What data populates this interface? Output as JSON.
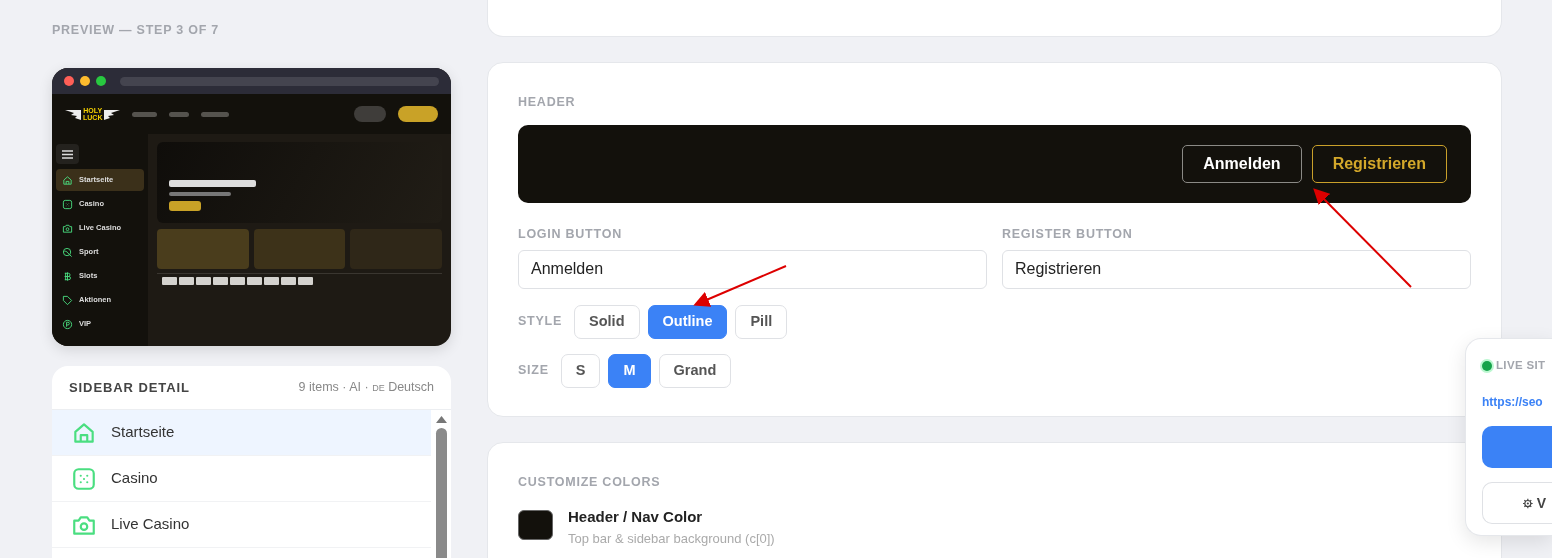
{
  "preview": {
    "label": "PREVIEW — STEP 3 OF 7",
    "mock": {
      "logo": [
        "HOLY",
        "LUCK"
      ],
      "nav_items": [
        {
          "label": "Startseite",
          "kind": "home",
          "selected": true
        },
        {
          "label": "Casino",
          "kind": "dice",
          "selected": false
        },
        {
          "label": "Live Casino",
          "kind": "camera",
          "selected": false
        },
        {
          "label": "Sport",
          "kind": "ball",
          "selected": false
        },
        {
          "label": "Slots",
          "kind": "coin",
          "selected": false
        },
        {
          "label": "Aktionen",
          "kind": "tag",
          "selected": false
        },
        {
          "label": "VIP",
          "kind": "vip",
          "selected": false
        }
      ]
    }
  },
  "sidebar_detail": {
    "title": "SIDEBAR DETAIL",
    "meta": "9 items · AI ·",
    "lang_code": "DE",
    "lang": "Deutsch",
    "items": [
      {
        "label": "Startseite",
        "kind": "home",
        "selected": true
      },
      {
        "label": "Casino",
        "kind": "dice",
        "selected": false
      },
      {
        "label": "Live Casino",
        "kind": "camera",
        "selected": false
      }
    ]
  },
  "header_section": {
    "title": "HEADER",
    "preview_login": "Anmelden",
    "preview_register": "Registrieren",
    "login_label": "LOGIN BUTTON",
    "login_value": "Anmelden",
    "register_label": "REGISTER BUTTON",
    "register_value": "Registrieren",
    "style_label": "STYLE",
    "styles": [
      {
        "label": "Solid",
        "selected": false
      },
      {
        "label": "Outline",
        "selected": true
      },
      {
        "label": "Pill",
        "selected": false
      }
    ],
    "size_label": "SIZE",
    "sizes": [
      {
        "label": "S",
        "selected": false
      },
      {
        "label": "M",
        "selected": true
      },
      {
        "label": "Grand",
        "selected": false
      }
    ]
  },
  "colors": {
    "title": "CUSTOMIZE COLORS",
    "items": [
      {
        "name": "Header / Nav Color",
        "description": "Top bar & sidebar background (c[0])",
        "color": "#13110c"
      }
    ]
  },
  "live_panel": {
    "title": "LIVE SIT",
    "online": true,
    "url": "https://seo",
    "settings_label": "V"
  }
}
